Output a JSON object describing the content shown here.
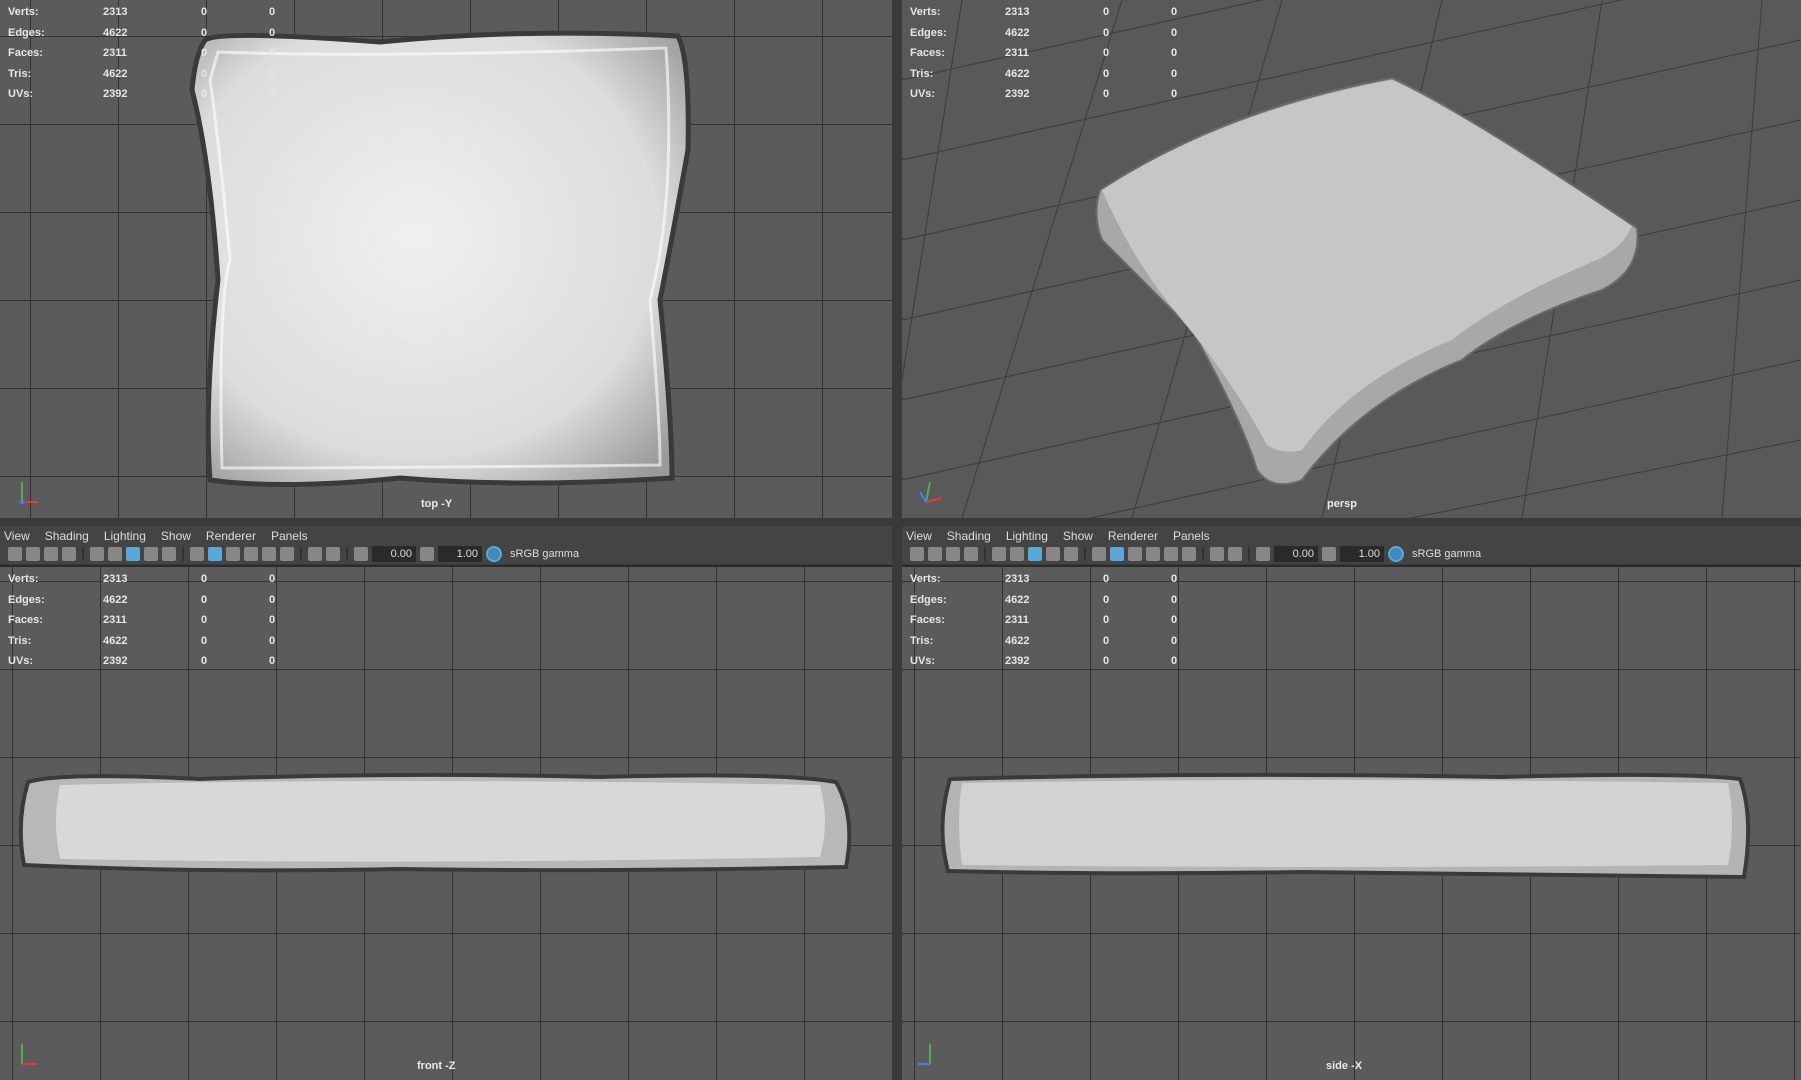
{
  "stats_labels": [
    "Verts:",
    "Edges:",
    "Faces:",
    "Tris:",
    "UVs:"
  ],
  "stats_values": {
    "verts": [
      "2313",
      "0",
      "0"
    ],
    "edges": [
      "4622",
      "0",
      "0"
    ],
    "faces": [
      "2311",
      "0",
      "0"
    ],
    "tris": [
      "4622",
      "0",
      "0"
    ],
    "uvs": [
      "2392",
      "0",
      "0"
    ]
  },
  "menu": [
    "View",
    "Shading",
    "Lighting",
    "Show",
    "Renderer",
    "Panels"
  ],
  "toolbar": {
    "exposure": "0.00",
    "gamma": "1.00",
    "colorspace": "sRGB gamma"
  },
  "viewports": {
    "top": "top -Y",
    "persp": "persp",
    "front": "front -Z",
    "side": "side -X"
  },
  "icons": [
    "camera-icon",
    "grid-icon",
    "wireframe-icon",
    "smooth-shade-icon",
    "texture-icon",
    "light-icon",
    "isolate-icon",
    "xray-icon",
    "exposure-icon",
    "gamma-icon",
    "colorspace-icon"
  ],
  "colors": {
    "accent": "#5aa8d8",
    "viewport_bg": "#5b5b5b",
    "grid": "#333333"
  }
}
